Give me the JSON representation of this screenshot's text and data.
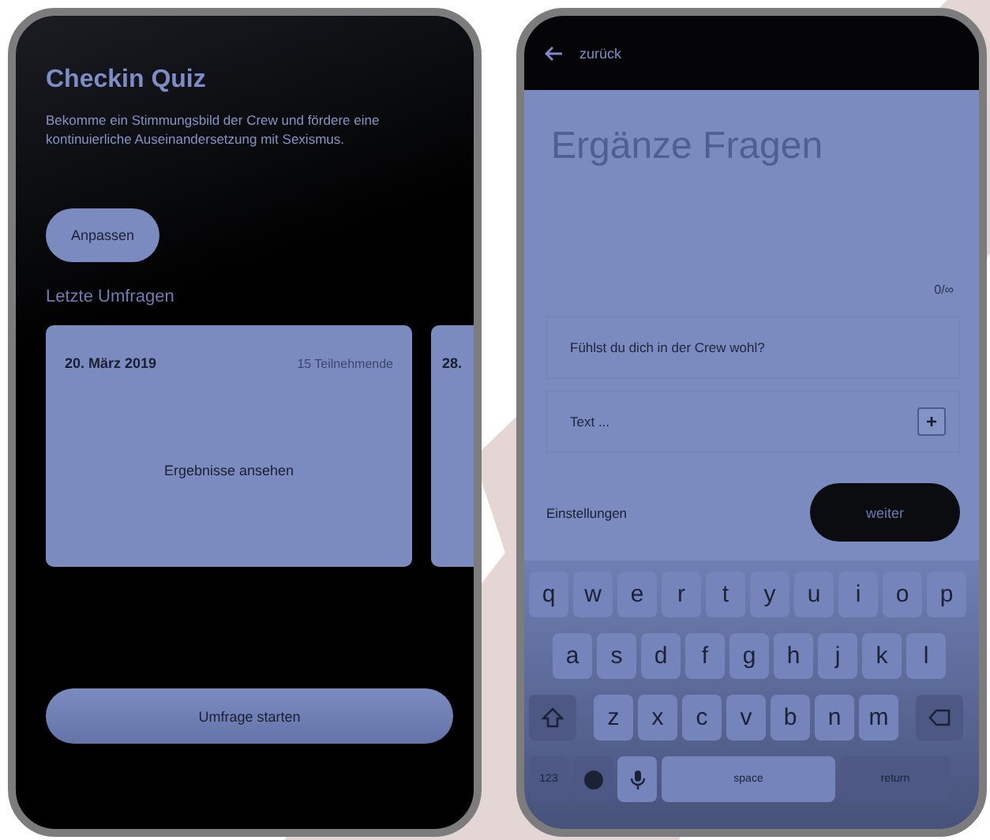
{
  "left_screen": {
    "title": "Checkin Quiz",
    "description": "Bekomme ein Stimmungsbild der Crew und fördere eine kontinuierliche Auseinandersetzung mit Sexismus.",
    "customize_button": "Anpassen",
    "section_title": "Letzte Umfragen",
    "surveys": [
      {
        "date": "20. März 2019",
        "participants": "15 Teilnehmende",
        "action": "Ergebnisse ansehen"
      },
      {
        "date": "28."
      }
    ],
    "start_button": "Umfrage starten"
  },
  "right_screen": {
    "back_label": "zurück",
    "title": "Ergänze Fragen",
    "counter": "0/∞",
    "questions": [
      {
        "text": "Fühlst du dich in der Crew wohl?"
      }
    ],
    "new_question": {
      "placeholder": "Text ..."
    },
    "add_button": "+",
    "settings_link": "Einstellungen",
    "next_button": "weiter"
  },
  "keyboard": {
    "rows": [
      {
        "keys": [
          {
            "kind": "char",
            "label": "q"
          },
          {
            "kind": "char",
            "label": "w"
          },
          {
            "kind": "char",
            "label": "e"
          },
          {
            "kind": "char",
            "label": "r"
          },
          {
            "kind": "char",
            "label": "t"
          },
          {
            "kind": "char",
            "label": "y"
          },
          {
            "kind": "char",
            "label": "u"
          },
          {
            "kind": "char",
            "label": "i"
          },
          {
            "kind": "char",
            "label": "o"
          },
          {
            "kind": "char",
            "label": "p"
          }
        ]
      },
      {
        "keys": [
          {
            "kind": "char",
            "label": "a"
          },
          {
            "kind": "char",
            "label": "s"
          },
          {
            "kind": "char",
            "label": "d"
          },
          {
            "kind": "char",
            "label": "f"
          },
          {
            "kind": "char",
            "label": "g"
          },
          {
            "kind": "char",
            "label": "h"
          },
          {
            "kind": "char",
            "label": "j"
          },
          {
            "kind": "char",
            "label": "k"
          },
          {
            "kind": "char",
            "label": "l"
          }
        ]
      },
      {
        "keys": [
          {
            "kind": "shift"
          },
          {
            "kind": "char",
            "label": "z"
          },
          {
            "kind": "char",
            "label": "x"
          },
          {
            "kind": "char",
            "label": "c"
          },
          {
            "kind": "char",
            "label": "v"
          },
          {
            "kind": "char",
            "label": "b"
          },
          {
            "kind": "char",
            "label": "n"
          },
          {
            "kind": "char",
            "label": "m"
          },
          {
            "kind": "backspace"
          }
        ]
      },
      {
        "keys": [
          {
            "kind": "function",
            "label": "123"
          },
          {
            "kind": "emoji"
          },
          {
            "kind": "mic"
          },
          {
            "kind": "space",
            "label": "space"
          },
          {
            "kind": "function",
            "label": "return"
          }
        ]
      }
    ]
  }
}
